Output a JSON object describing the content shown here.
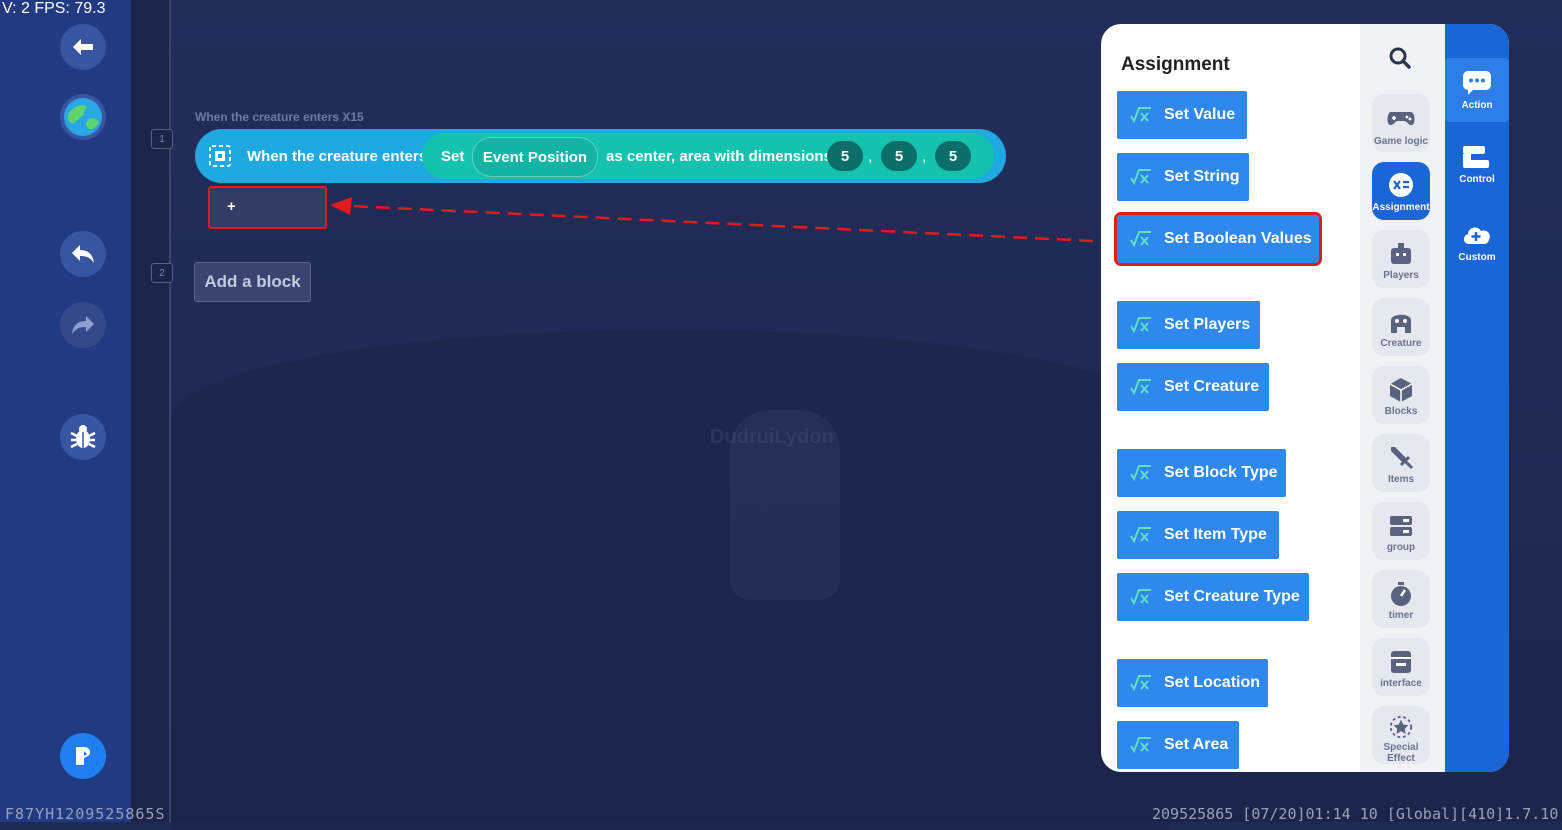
{
  "debug": {
    "fps_text": "V: 2 FPS: 79.3"
  },
  "sidebar": {
    "buttons": [
      {
        "name": "back-button",
        "icon": "arrow-left-icon"
      },
      {
        "name": "world-button",
        "icon": "globe-icon"
      },
      {
        "name": "undo-button",
        "icon": "undo-icon"
      },
      {
        "name": "redo-button",
        "icon": "redo-icon"
      },
      {
        "name": "debug-button",
        "icon": "bug-icon"
      },
      {
        "name": "run-button",
        "icon": "play-icon"
      }
    ]
  },
  "editor": {
    "line_numbers": [
      "1",
      "2"
    ],
    "event_caption": "When the creature enters X15",
    "event": {
      "trigger": "When the creature enters",
      "set_label": "Set",
      "position": "Event Position",
      "area_text": "as center, area with dimensions (",
      "dims": [
        "5",
        "5",
        "5"
      ],
      "separator": ","
    },
    "slot_plus": "+",
    "add_block": "Add a block",
    "ghost_name": "DudruiLydon"
  },
  "panel": {
    "title": "Assignment",
    "buttons": [
      "Set Value",
      "Set String",
      "Set Boolean Values",
      "Set Players",
      "Set Creature",
      "Set Block Type",
      "Set Item Type",
      "Set Creature Type",
      "Set Location",
      "Set Area"
    ],
    "highlighted": "Set Boolean Values",
    "categories": [
      {
        "label": "Game logic",
        "icon": "gamepad-icon"
      },
      {
        "label": "Assignment",
        "icon": "assignment-icon"
      },
      {
        "label": "Players",
        "icon": "player-icon"
      },
      {
        "label": "Creature",
        "icon": "creature-icon"
      },
      {
        "label": "Blocks",
        "icon": "cube-icon"
      },
      {
        "label": "Items",
        "icon": "sword-icon"
      },
      {
        "label": "group",
        "icon": "group-icon"
      },
      {
        "label": "timer",
        "icon": "stopwatch-icon"
      },
      {
        "label": "interface",
        "icon": "interface-icon"
      },
      {
        "label": "Special Effect",
        "icon": "star-icon"
      }
    ],
    "active_category": "Assignment",
    "tabs": [
      {
        "label": "Action",
        "icon": "chat-bubble-icon"
      },
      {
        "label": "Control",
        "icon": "control-icon"
      },
      {
        "label": "Custom",
        "icon": "plus-cloud-icon"
      }
    ],
    "active_tab": "Action"
  },
  "footer": {
    "left": "F87YH1209525865S",
    "right": "209525865  [07/20]01:14 10  [Global][410]1.7.10"
  },
  "colors": {
    "highlight": "#e21a1a",
    "event_block": "#1ea9e1",
    "event_inner": "#14c2ae",
    "assign_button": "#2e88ee",
    "tab_column": "#1a66d6"
  }
}
